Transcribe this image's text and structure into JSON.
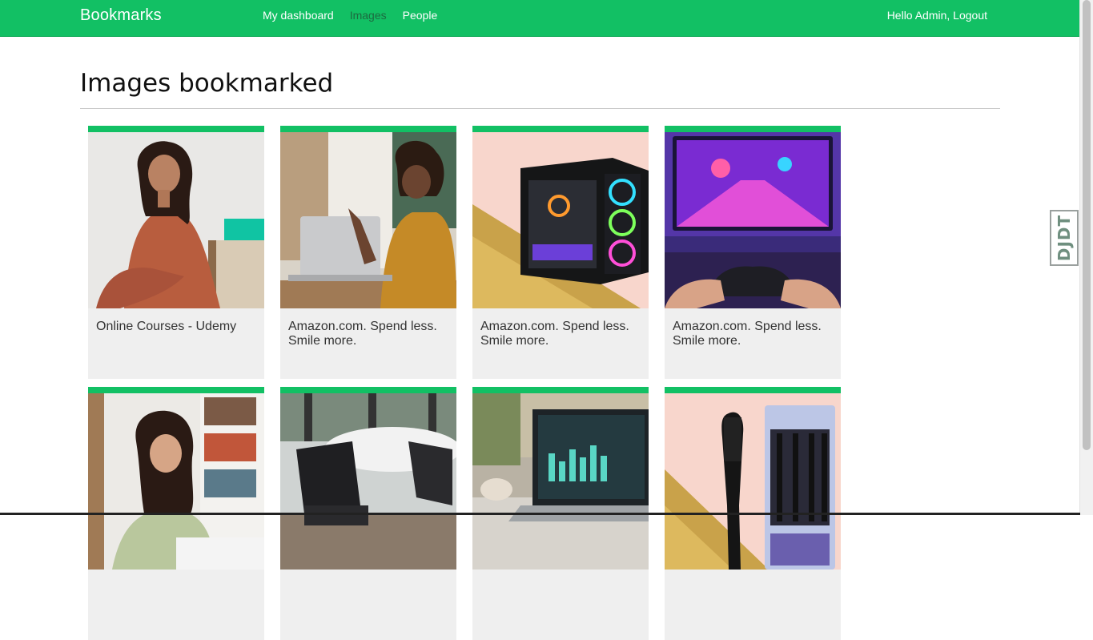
{
  "header": {
    "brand": "Bookmarks",
    "nav": [
      {
        "label": "My dashboard",
        "active": false
      },
      {
        "label": "Images",
        "active": true
      },
      {
        "label": "People",
        "active": false
      }
    ],
    "greeting": "Hello Admin,",
    "logout": "Logout"
  },
  "main": {
    "title": "Images bookmarked",
    "cards": [
      {
        "title": "Online Courses - Udemy",
        "image": "woman-portrait-photo"
      },
      {
        "title": "Amazon.com. Spend less. Smile more.",
        "image": "woman-laptop-photo"
      },
      {
        "title": "Amazon.com. Spend less. Smile more.",
        "image": "gaming-pc-photo"
      },
      {
        "title": "Amazon.com. Spend less. Smile more.",
        "image": "gaming-controller-photo"
      },
      {
        "title": "",
        "image": "student-laptop-photo"
      },
      {
        "title": "",
        "image": "office-chairs-photo"
      },
      {
        "title": "",
        "image": "laptop-dashboard-photo"
      },
      {
        "title": "",
        "image": "toothbrush-pack-photo"
      }
    ]
  },
  "debug_toolbar": {
    "label": "DJDT"
  },
  "colors": {
    "accent": "#12c064",
    "card_bg": "#efefef",
    "active_nav": "#1d6a40"
  }
}
